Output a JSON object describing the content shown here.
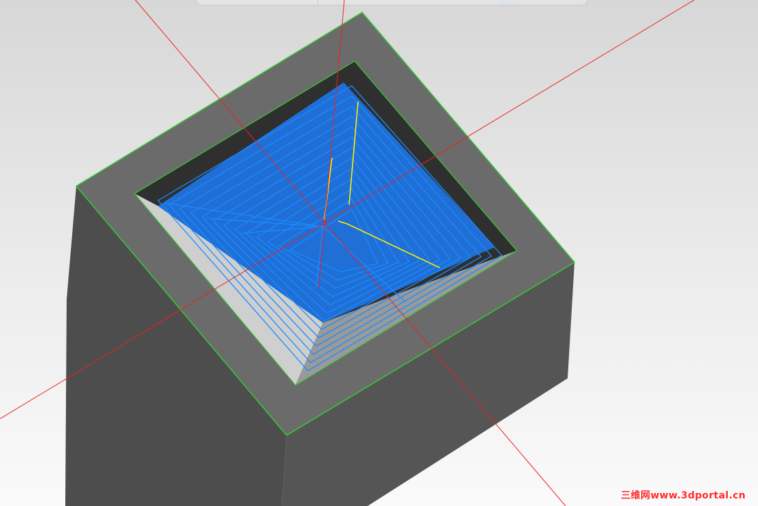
{
  "viewport": {
    "background_top": "#d7d7d7",
    "background_bottom": "#fafafa",
    "model": {
      "type": "rectangular block with inverted pyramid pocket",
      "top_face_color": "#6a6a6a",
      "left_face_color": "#4d4d4d",
      "right_face_color": "#555555",
      "pocket_wall_color": "#3e3e3e",
      "edge_highlight_color": "#33cc33"
    },
    "toolpath": {
      "color": "#1a8cff",
      "path_type": "pocket spiral / zig offset passes",
      "engage_line_color": "#ffee00"
    },
    "axes": {
      "color": "#ee2020"
    }
  },
  "watermark": {
    "text": "三维网www.3dportal.cn"
  }
}
